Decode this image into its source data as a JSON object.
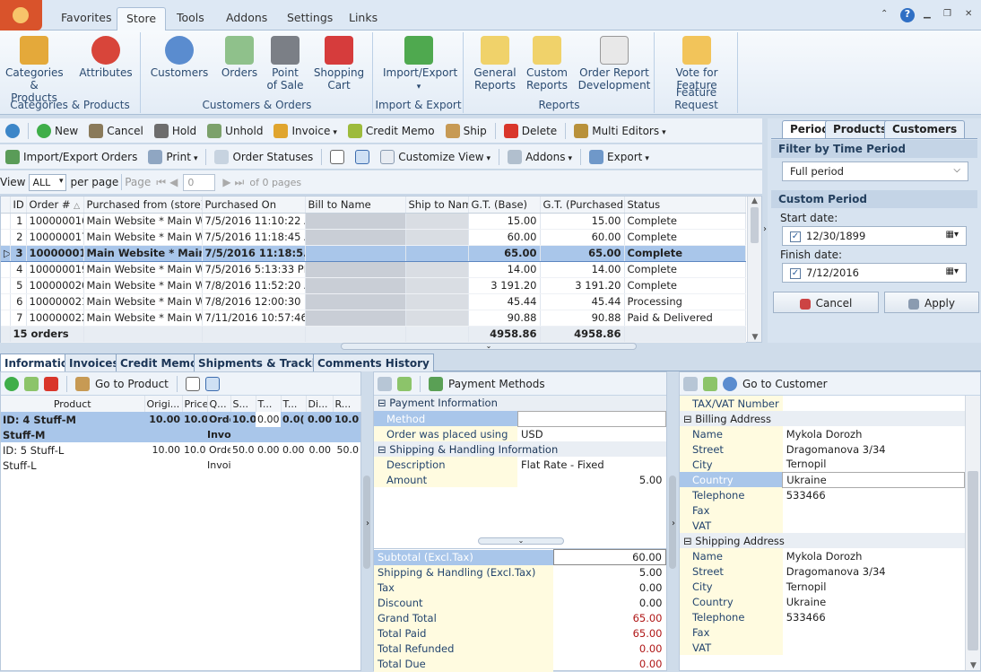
{
  "ribbon_tabs": [
    "Favorites",
    "Store",
    "Tools",
    "Addons",
    "Settings",
    "Links"
  ],
  "ribbon_groups": [
    {
      "label": "Categories & Products",
      "buttons": [
        "Categories\n& Products",
        "Attributes"
      ]
    },
    {
      "label": "Customers & Orders",
      "buttons": [
        "Customers",
        "Orders",
        "Point\nof Sale",
        "Shopping\nCart"
      ]
    },
    {
      "label": "Import & Export",
      "buttons": [
        "Import/Export"
      ]
    },
    {
      "label": "Reports",
      "buttons": [
        "General\nReports",
        "Custom\nReports",
        "Order Report\nDevelopment"
      ]
    },
    {
      "label": "Feature Request",
      "buttons": [
        "Vote for\nFeature"
      ]
    }
  ],
  "toolbar1": [
    "New",
    "Cancel",
    "Hold",
    "Unhold",
    "Invoice",
    "Credit Memo",
    "Ship",
    "Delete",
    "Multi Editors"
  ],
  "toolbar2": [
    "Import/Export Orders",
    "Print",
    "Order Statuses",
    "Customize View",
    "Addons",
    "Export"
  ],
  "pager": {
    "view_label": "View",
    "view_value": "ALL",
    "per_page": "per page",
    "page_label": "Page",
    "page_value": "0",
    "of_pages": "of 0 pages"
  },
  "grid": {
    "headers": [
      "ID",
      "Order #",
      "Purchased from (store)",
      "Purchased On",
      "Bill to Name",
      "Ship to Name",
      "G.T. (Base)",
      "G.T. (Purchased)",
      "Status"
    ],
    "rows": [
      [
        "1",
        "100000016",
        "Main Website * Main W...",
        "7/5/2016 11:10:22 AM",
        "",
        "",
        "15.00",
        "15.00",
        "Complete"
      ],
      [
        "2",
        "100000017",
        "Main Website * Main W...",
        "7/5/2016 11:18:45 AM",
        "",
        "",
        "60.00",
        "60.00",
        "Complete"
      ],
      [
        "3",
        "100000018",
        "Main Website * Main...",
        "7/5/2016 11:18:5...",
        "",
        "",
        "65.00",
        "65.00",
        "Complete"
      ],
      [
        "4",
        "100000019",
        "Main Website * Main W...",
        "7/5/2016 5:13:33 PM",
        "",
        "",
        "14.00",
        "14.00",
        "Complete"
      ],
      [
        "5",
        "100000020",
        "Main Website * Main W...",
        "7/8/2016 11:52:20 AM",
        "",
        "",
        "3 191.20",
        "3 191.20",
        "Complete"
      ],
      [
        "6",
        "100000021",
        "Main Website * Main W...",
        "7/8/2016 12:00:30 PM",
        "",
        "",
        "45.44",
        "45.44",
        "Processing"
      ],
      [
        "7",
        "100000022",
        "Main Website * Main W...",
        "7/11/2016 10:57:46...",
        "",
        "",
        "90.88",
        "90.88",
        "Paid & Delivered"
      ]
    ],
    "footer_count": "15 orders",
    "footer_base": "4958.86",
    "footer_purchased": "4958.86"
  },
  "right_panel": {
    "tabs": [
      "Period",
      "Products",
      "Customers"
    ],
    "filter_title": "Filter by Time Period",
    "filter_value": "Full period",
    "custom_title": "Custom Period",
    "start_label": "Start date:",
    "start_value": "12/30/1899",
    "finish_label": "Finish date:",
    "finish_value": "7/12/2016",
    "cancel": "Cancel",
    "apply": "Apply"
  },
  "bottom_tabs": [
    "Information",
    "Invoices",
    "Credit Memos",
    "Shipments & Tracking",
    "Comments History"
  ],
  "items": {
    "goto": "Go to Product",
    "headers": [
      "Product",
      "Origi...",
      "Price",
      "Q...",
      "S...",
      "T...",
      "T...",
      "Di...",
      "R..."
    ],
    "rows": [
      {
        "name": "ID: 4 Stuff-M",
        "sub": "Stuff-M",
        "cells": [
          "10.00",
          "10.0",
          "Orde",
          "10.0",
          "0.00",
          "0.0(",
          "0.00",
          "10.0"
        ],
        "sub2": "Invo"
      },
      {
        "name": "ID: 5 Stuff-L",
        "sub": "Stuff-L",
        "cells": [
          "10.00",
          "10.0",
          "Orde",
          "50.0",
          "0.00",
          "0.00",
          "0.00",
          "50.0"
        ],
        "sub2": "Invoi"
      }
    ]
  },
  "payment": {
    "toolbar": "Payment Methods",
    "sec1": "Payment Information",
    "method_label": "Method",
    "method_value": "",
    "placed_label": "Order was placed using",
    "placed_value": "USD",
    "sec2": "Shipping & Handling Information",
    "desc_label": "Description",
    "desc_value": "Flat Rate - Fixed",
    "amount_label": "Amount",
    "amount_value": "5.00"
  },
  "totals": [
    {
      "k": "Subtotal (Excl.Tax)",
      "v": "60.00",
      "red": false
    },
    {
      "k": "Shipping & Handling (Excl.Tax)",
      "v": "5.00",
      "red": false
    },
    {
      "k": "Tax",
      "v": "0.00",
      "red": false
    },
    {
      "k": "Discount",
      "v": "0.00",
      "red": false
    },
    {
      "k": "Grand Total",
      "v": "65.00",
      "red": true
    },
    {
      "k": "Total Paid",
      "v": "65.00",
      "red": true
    },
    {
      "k": "Total Refunded",
      "v": "0.00",
      "red": true
    },
    {
      "k": "Total Due",
      "v": "0.00",
      "red": true
    }
  ],
  "customer": {
    "toolbar": "Go to Customer",
    "vat_top": "TAX/VAT Number",
    "billing": "Billing Address",
    "shipping": "Shipping Address",
    "fields": [
      "Name",
      "Street",
      "City",
      "Country",
      "Telephone",
      "Fax",
      "VAT"
    ],
    "billing_values": [
      "Mykola Dorozh",
      "Dragomanova 3/34",
      "Ternopil",
      "Ukraine",
      "533466",
      "",
      ""
    ],
    "shipping_values": [
      "Mykola Dorozh",
      "Dragomanova 3/34",
      "Ternopil",
      "Ukraine",
      "533466",
      "",
      ""
    ]
  }
}
